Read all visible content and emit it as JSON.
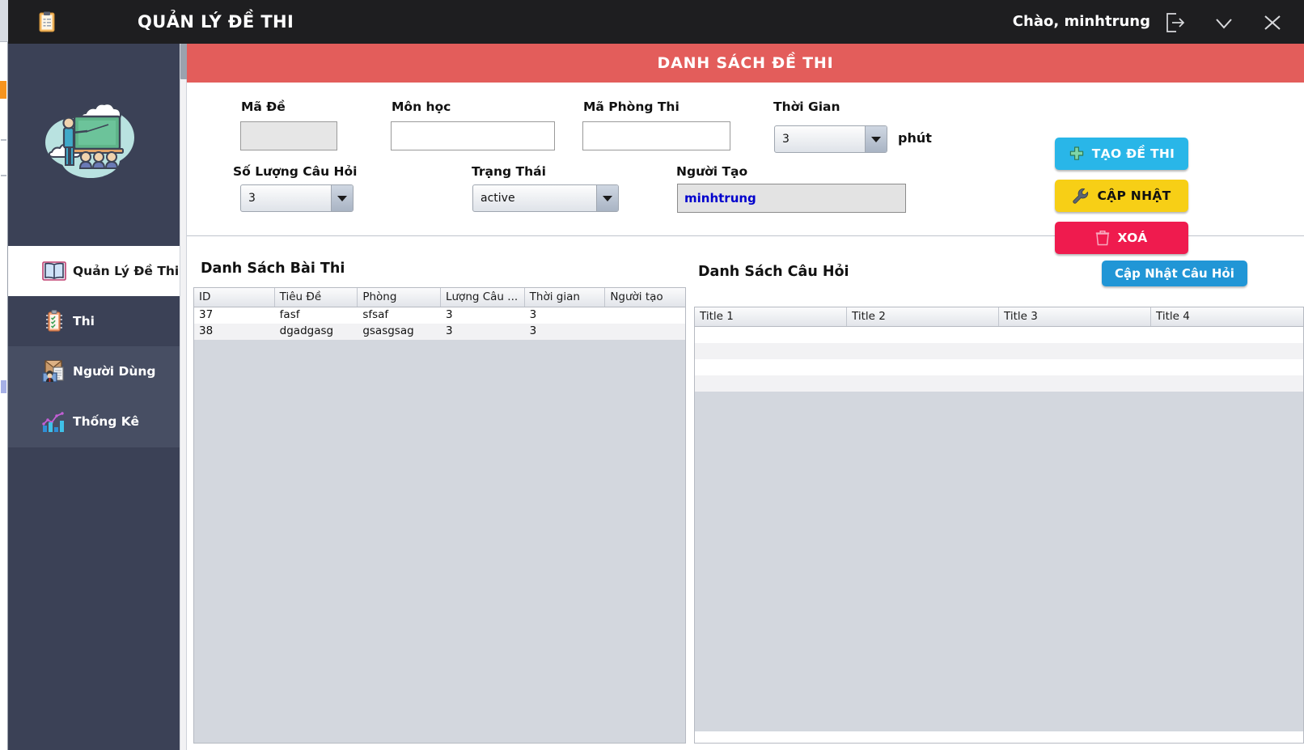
{
  "titlebar": {
    "app_icon": "clipboard-icon",
    "title": "QUẢN LÝ ĐỀ THI",
    "greeting": "Chào, minhtrung",
    "logout_icon": "logout-icon",
    "minimize_icon": "chevron-down-icon",
    "close_icon": "close-icon"
  },
  "sidebar": {
    "logo": "classroom-illustration",
    "items": [
      {
        "label": "Quản Lý Đề Thi",
        "icon": "open-book-icon",
        "active": true
      },
      {
        "label": "Thi",
        "icon": "clipboard-check-icon",
        "active": false
      },
      {
        "label": "Người Dùng",
        "icon": "user-group-icon",
        "active": false
      },
      {
        "label": "Thống Kê",
        "icon": "bar-chart-icon",
        "active": false
      }
    ]
  },
  "banner": {
    "title": "DANH SÁCH ĐỀ THI"
  },
  "form": {
    "ma_de": {
      "label": "Mã Đề",
      "value": "",
      "placeholder": ""
    },
    "mon_hoc": {
      "label": "Môn học",
      "value": "",
      "placeholder": ""
    },
    "ma_phong_thi": {
      "label": "Mã Phòng Thi",
      "value": "",
      "placeholder": ""
    },
    "thoi_gian": {
      "label": "Thời Gian",
      "value": "3",
      "unit": "phút"
    },
    "so_luong_cau_hoi": {
      "label": "Số Lượng Câu Hỏi",
      "value": "3"
    },
    "trang_thai": {
      "label": "Trạng Thái",
      "value": "active"
    },
    "nguoi_tao": {
      "label": "Người Tạo",
      "value": "minhtrung"
    }
  },
  "actions": {
    "create": {
      "label": "TẠO ĐỀ THI",
      "icon": "plus-icon",
      "color": "#29b6e8"
    },
    "update": {
      "label": "CẬP NHẬT",
      "icon": "wrench-icon",
      "color": "#f7cf16"
    },
    "delete": {
      "label": "XOÁ",
      "icon": "trash-icon",
      "color": "#ef1b4e"
    }
  },
  "exam_list": {
    "title": "Danh Sách Bài Thi",
    "columns": [
      "ID",
      "Tiêu Đề",
      "Phòng",
      "Lượng Câu ...",
      "Thời gian",
      "Người tạo"
    ],
    "rows": [
      [
        "37",
        "fasf",
        "sfsaf",
        "3",
        "3",
        ""
      ],
      [
        "38",
        "dgadgasg",
        "gsasgsag",
        "3",
        "3",
        ""
      ]
    ]
  },
  "question_list": {
    "title": "Danh Sách Câu Hỏi",
    "update_button": "Cập Nhật Câu Hỏi",
    "columns": [
      "Title 1",
      "Title 2",
      "Title 3",
      "Title 4"
    ],
    "rows": [
      [
        "",
        "",
        "",
        ""
      ],
      [
        "",
        "",
        "",
        ""
      ],
      [
        "",
        "",
        "",
        ""
      ],
      [
        "",
        "",
        "",
        ""
      ]
    ]
  }
}
